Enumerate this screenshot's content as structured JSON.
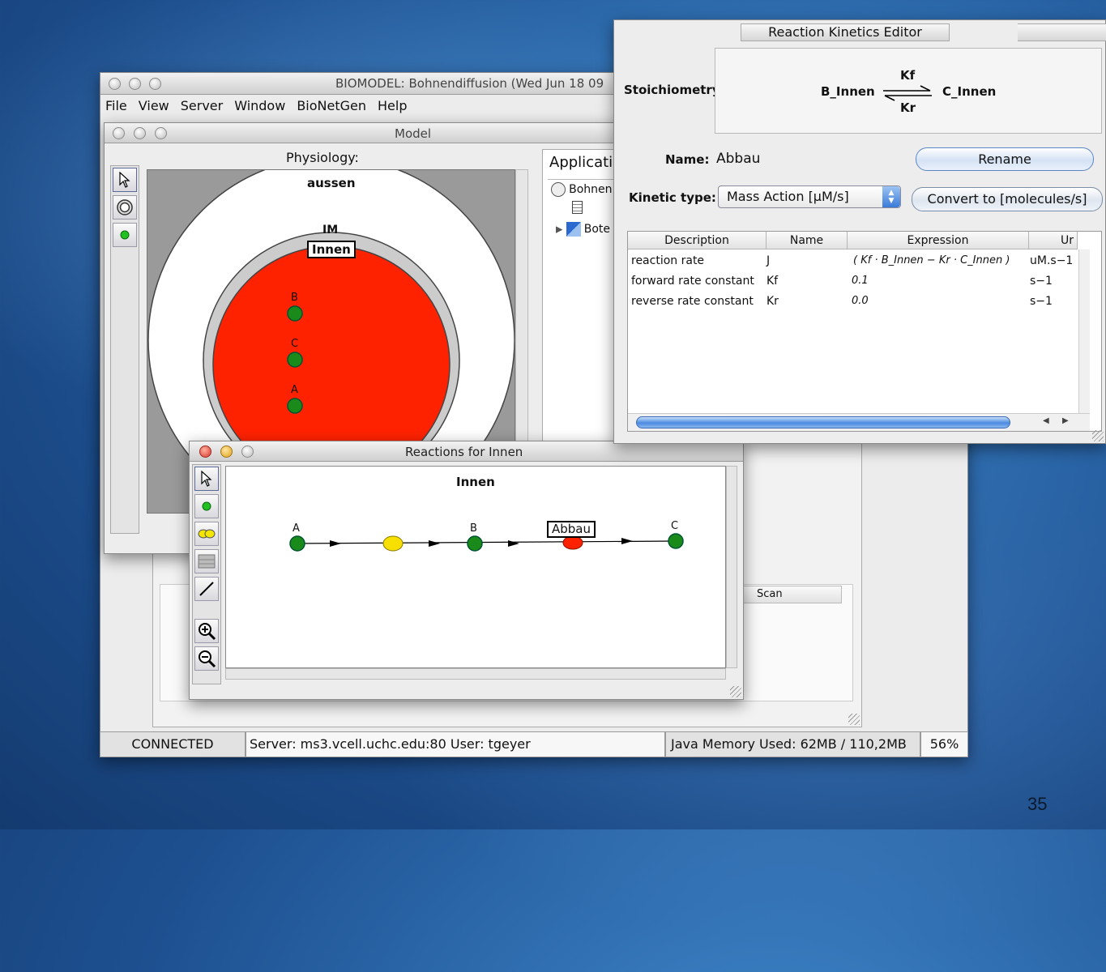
{
  "slide_number": "35",
  "main_window": {
    "title": "BIOMODEL: Bohnendiffusion (Wed Jun 18 09",
    "menu": [
      "File",
      "View",
      "Server",
      "Window",
      "BioNetGen",
      "Help"
    ],
    "status": {
      "connection": "CONNECTED",
      "server": "Server: ms3.vcell.uchc.edu:80 User: tgeyer",
      "memory": "Java Memory Used: 62MB / 110,2MB",
      "percent": "56%"
    },
    "scan_label": "Scan"
  },
  "model_window": {
    "title": "Model",
    "physiology_label": "Physiology:",
    "compartments": {
      "outer": "aussen",
      "membrane": "IM",
      "inner": "Innen"
    },
    "species": [
      "B",
      "C",
      "A"
    ],
    "applications": {
      "header": "Applicatio",
      "items": [
        "Bohnen",
        "Bote"
      ]
    }
  },
  "reactions_window": {
    "title": "Reactions for Innen",
    "compartment": "Innen",
    "species": [
      "A",
      "B",
      "C"
    ],
    "reaction_label": "Abbau"
  },
  "kinetics_editor": {
    "title": "Reaction Kinetics Editor",
    "stoichiometry_label": "Stoichiometry",
    "reactant": "B_Innen",
    "product": "C_Innen",
    "forward_label": "Kf",
    "reverse_label": "Kr",
    "name_label": "Name:",
    "name_value": "Abbau",
    "rename_button": "Rename",
    "kinetic_type_label": "Kinetic type:",
    "kinetic_type_value": "Mass Action [µM/s]",
    "convert_button": "Convert to [molecules/s]",
    "table": {
      "columns": [
        "Description",
        "Name",
        "Expression",
        "Ur"
      ],
      "rows": [
        {
          "description": "reaction rate",
          "name": "J",
          "expression": "( Kf · B_Innen  − Kr · C_Innen )",
          "unit": "uM.s−1"
        },
        {
          "description": "forward rate constant",
          "name": "Kf",
          "expression": "0.1",
          "unit": "s−1"
        },
        {
          "description": "reverse rate constant",
          "name": "Kr",
          "expression": "0.0",
          "unit": "s−1"
        }
      ]
    }
  }
}
